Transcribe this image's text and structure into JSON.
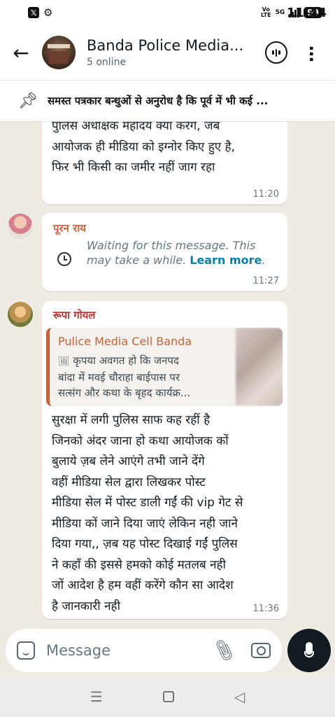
{
  "status_bar": {
    "time": "11:44",
    "network": "Vo LTE",
    "signal": "5G",
    "battery": "99"
  },
  "header": {
    "title": "Banda Police Media...",
    "subtitle": "5 online",
    "avatar_text": "BANDA POLICE"
  },
  "pinned": {
    "text": "समस्त पत्रकार बन्धुओं से अनुरोध है कि पूर्व में भी कई ..."
  },
  "messages": [
    {
      "lines": [
        "पुलिस अधीक्षक महोदय क्या करेंगे, जब",
        "आयोजक ही मीडिया को इग्नोर किए हुए है,",
        "फिर भी किसी का जमीर नहीं जाग रहा"
      ],
      "time": "11:20"
    },
    {
      "sender": "पूरन राय",
      "sender_color": "#c4633b",
      "waiting_line1": "Waiting for this message. This",
      "waiting_line2": "may take a while.",
      "learn_more": "Learn more",
      "period": ".",
      "time": "11:27"
    },
    {
      "sender": "रूपा गोयल",
      "sender_color": "#b7352e",
      "quote": {
        "name": "Pulice Media Cell Banda",
        "lines": [
          "कृपया अवगत हो कि जनपद",
          "बांदा में मवई चौराहा बाईपास पर",
          "सत्संग और कथा के बृहद कार्यक्र..."
        ]
      },
      "lines": [
        "सुरक्षा में लगी पुलिस साफ कह रहीं है",
        "जिनको अंदर जाना हो कथा आयोजक कों",
        "बुलाये ज़ब लेने आएंगे तभी जाने देंगे",
        "वहीं मीडिया सेल द्वारा  लिखकर पोस्ट",
        "मीडिया सेल में पोस्ट डाली गईं की vip गेट से",
        "मीडिया कों जाने दिया जाएं लेकिन नही जाने",
        "दिया गया,, ज़ब यह पोस्ट दिखाई गईं पुलिस",
        "ने कहाँ की इससे हमको कोई मतलब नही",
        "जों आदेश है हम वहीं करेंगे कौन सा आदेश",
        "है जानकारी नही"
      ],
      "time": "11:36"
    }
  ],
  "composer": {
    "placeholder": "Message"
  }
}
